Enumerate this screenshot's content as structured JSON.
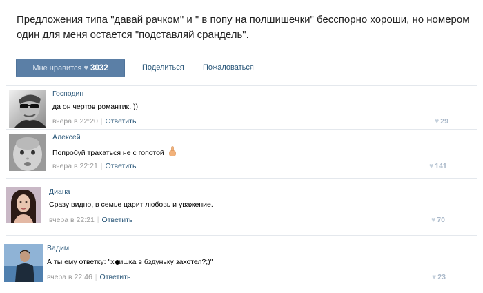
{
  "post": {
    "text": "Предложения типа \"давай рачком\" и \" в попу на полшишечки\" бесспорно хороши, но номером один для меня остается \"подставляй срандель\"."
  },
  "actions": {
    "like_label": "Мне нравится",
    "like_icon": "heart-icon",
    "like_count": "3032",
    "share_label": "Поделиться",
    "report_label": "Пожаловаться"
  },
  "comments": [
    {
      "author": "Господин",
      "text": "да он чертов романтик. ))",
      "time": "вчера в 22:20",
      "reply": "Ответить",
      "likes": "29"
    },
    {
      "author": "Алексей",
      "text": "Попробуй трахаться не с гопотой",
      "emoji": "middle-finger-icon",
      "time": "вчера в 22:21",
      "reply": "Ответить",
      "likes": "141"
    },
    {
      "author": "Диана",
      "text": "Сразу видно, в семье царит любовь и уважение.",
      "time": "вчера в 22:21",
      "reply": "Ответить",
      "likes": "70"
    },
    {
      "author": "Вадим",
      "text_before": "А ты ему ответку: \"х",
      "text_after": "ишка в бздуньку захотел?;)\"",
      "time": "вчера в 22:46",
      "reply": "Ответить",
      "likes": "23"
    }
  ],
  "colors": {
    "link": "#2b587a",
    "button": "#5b7fa6",
    "meta": "#999999",
    "like_count": "#a9b8c9"
  }
}
